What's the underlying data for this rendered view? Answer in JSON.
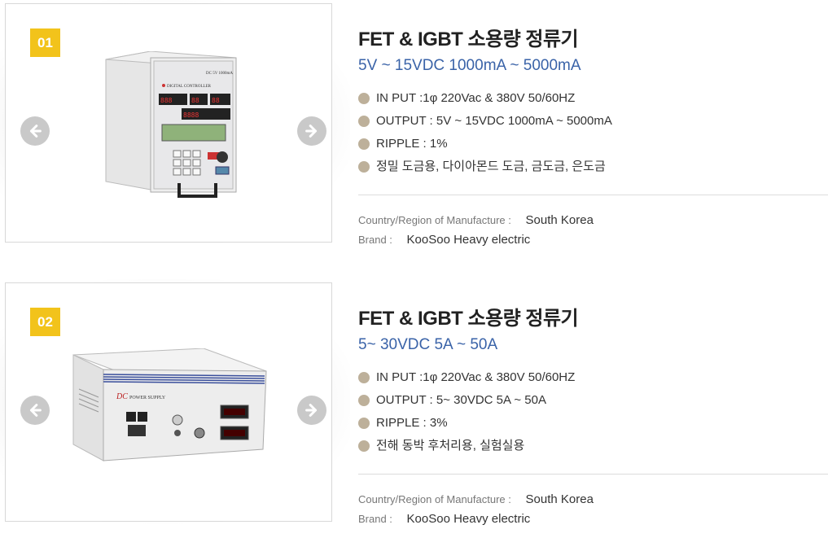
{
  "products": [
    {
      "badge": "01",
      "title": "FET & IGBT 소용량 정류기",
      "subtitle": "5V ~ 15VDC 1000mA ~ 5000mA",
      "specs": [
        "IN PUT :1φ 220Vac & 380V 50/60HZ",
        "OUTPUT : 5V ~ 15VDC 1000mA ~ 5000mA",
        "RIPPLE : 1%",
        "정밀 도금용, 다이아몬드 도금, 금도금, 은도금"
      ],
      "country_label": "Country/Region of Manufacture :",
      "country_value": "South Korea",
      "brand_label": "Brand :",
      "brand_value": "KooSoo Heavy electric",
      "image_label": "DC 5V 1000mA",
      "image_sublabel": "DIGITAL CONTROLLER"
    },
    {
      "badge": "02",
      "title": "FET & IGBT 소용량 정류기",
      "subtitle": "5~ 30VDC 5A ~ 50A",
      "specs": [
        "IN PUT :1φ 220Vac & 380V 50/60HZ",
        "OUTPUT : 5~ 30VDC 5A ~ 50A",
        "RIPPLE : 3%",
        "전해 동박 후처리용, 실험실용"
      ],
      "country_label": "Country/Region of Manufacture :",
      "country_value": "South Korea",
      "brand_label": "Brand :",
      "brand_value": "KooSoo Heavy electric",
      "image_label": "DC",
      "image_sublabel": "POWER SUPPLY"
    }
  ],
  "icons": {
    "prev": "arrow-left-icon",
    "next": "arrow-right-icon"
  },
  "colors": {
    "badge": "#f2c31b",
    "subtitle": "#3a63a8",
    "bullet": "#bdb09a",
    "arrow": "#c9c9c9"
  }
}
